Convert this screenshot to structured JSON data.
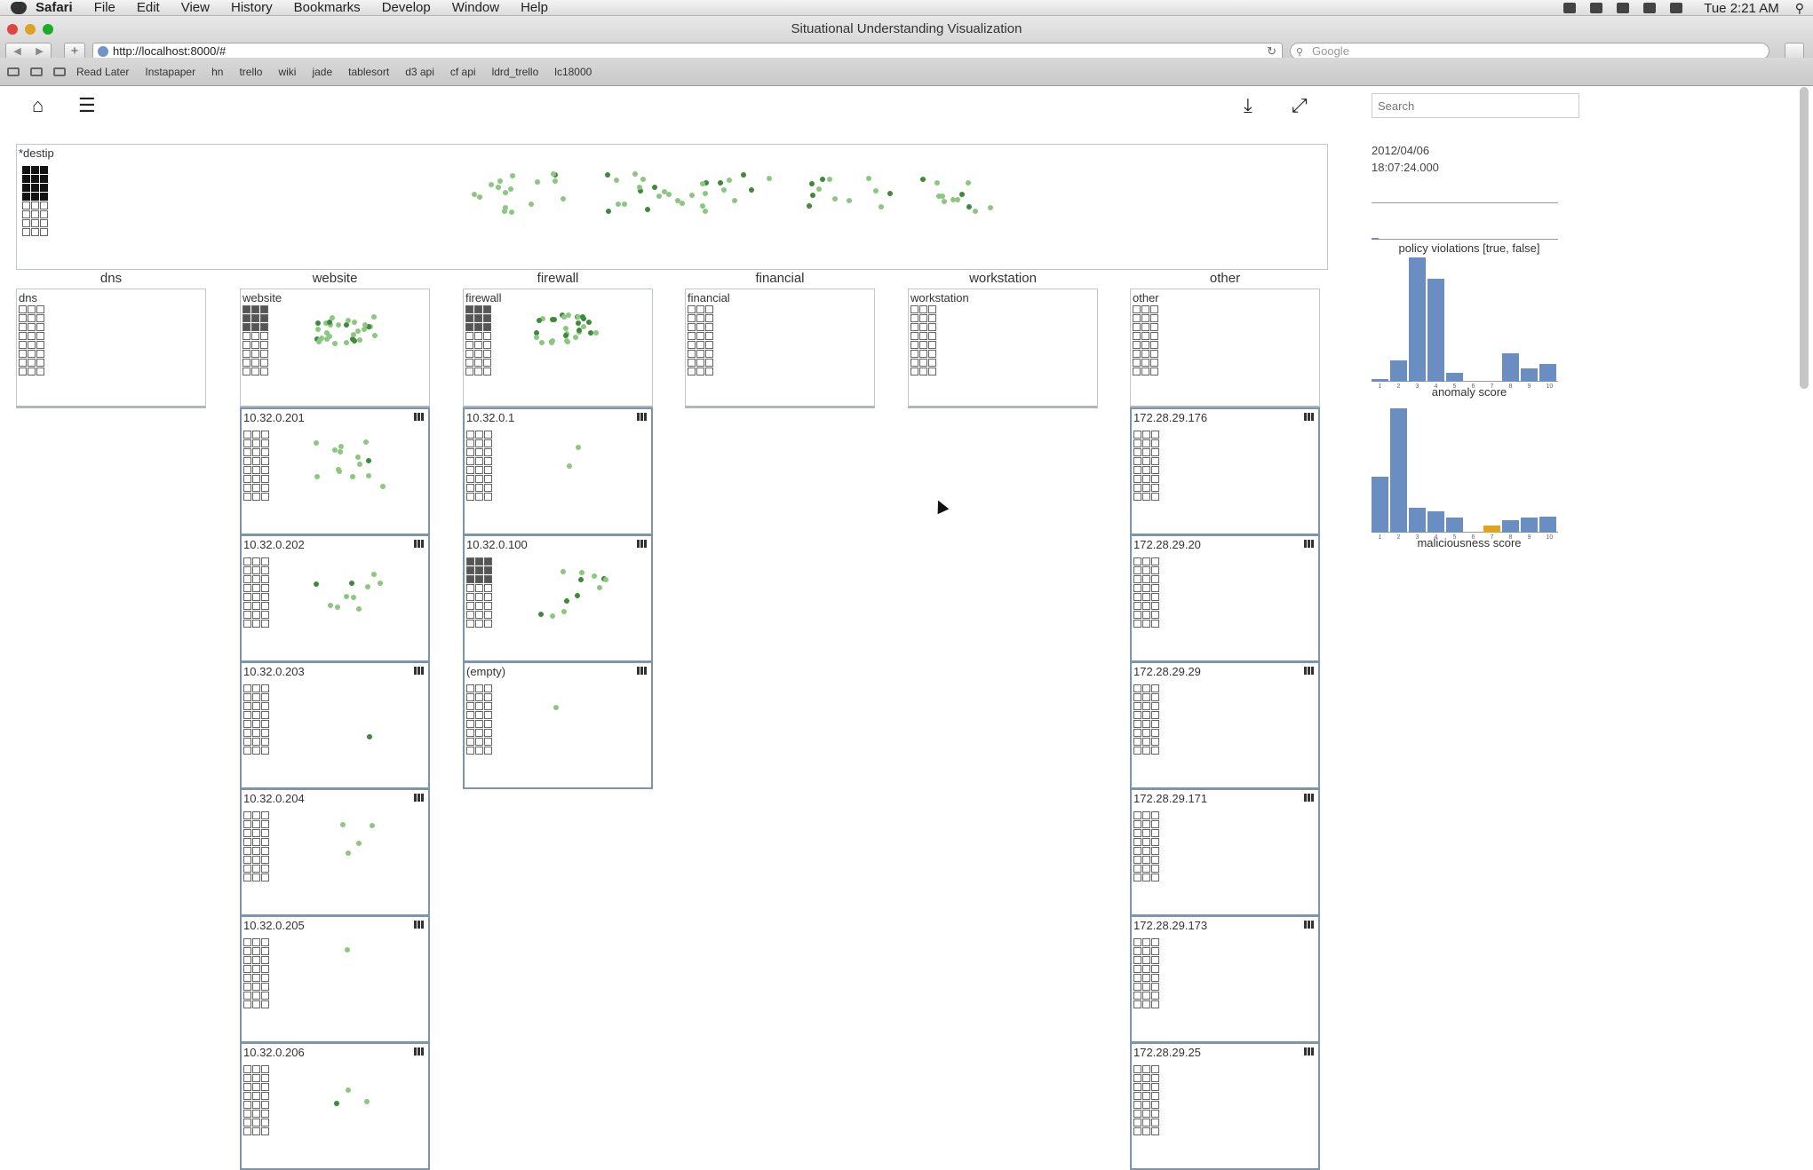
{
  "menubar": {
    "app": "Safari",
    "items": [
      "File",
      "Edit",
      "View",
      "History",
      "Bookmarks",
      "Develop",
      "Window",
      "Help"
    ],
    "clock": "Tue 2:21 AM"
  },
  "browser": {
    "window_title": "Situational Understanding Visualization",
    "url": "http://localhost:8000/#",
    "search_placeholder": "Google",
    "bookmarks": [
      "Read Later",
      "Instapaper",
      "hn",
      "trello",
      "wiki",
      "jade",
      "tablesort",
      "d3 api",
      "cf api",
      "ldrd_trello",
      "lc18000"
    ]
  },
  "toolbar": {
    "home_icon": "home-icon",
    "list_icon": "list-icon",
    "download_icon": "download-icon",
    "expand_icon": "expand-icon"
  },
  "top_panel": {
    "label": "*destip"
  },
  "columns": [
    {
      "title": "dns",
      "summary_label": "dns",
      "hosts": []
    },
    {
      "title": "website",
      "summary_label": "website",
      "hosts": [
        "10.32.0.201",
        "10.32.0.202",
        "10.32.0.203",
        "10.32.0.204",
        "10.32.0.205",
        "10.32.0.206"
      ]
    },
    {
      "title": "firewall",
      "summary_label": "firewall",
      "hosts": [
        "10.32.0.1",
        "10.32.0.100",
        "(empty)"
      ]
    },
    {
      "title": "financial",
      "summary_label": "financial",
      "hosts": []
    },
    {
      "title": "workstation",
      "summary_label": "workstation",
      "hosts": []
    },
    {
      "title": "other",
      "summary_label": "other",
      "hosts": [
        "172.28.29.176",
        "172.28.29.20",
        "172.28.29.29",
        "172.28.29.171",
        "172.28.29.173",
        "172.28.29.25"
      ]
    }
  ],
  "sidebar": {
    "search_placeholder": "Search",
    "date": "2012/04/06",
    "time": "18:07:24.000",
    "charts": [
      {
        "caption": "policy violations [true, false]",
        "values": [
          1.0,
          0
        ]
      },
      {
        "caption": "anomaly score",
        "ticks": [
          "1",
          "2",
          "3",
          "4",
          "5",
          "6",
          "7",
          "8",
          "9",
          "10"
        ],
        "values": [
          2,
          17,
          100,
          83,
          7,
          0,
          0,
          23,
          11,
          14
        ]
      },
      {
        "caption": "maliciousness score",
        "ticks": [
          "1",
          "2",
          "3",
          "4",
          "5",
          "6",
          "7",
          "8",
          "9",
          "10"
        ],
        "values": [
          45,
          100,
          20,
          17,
          12,
          0,
          6,
          10,
          12,
          13
        ],
        "highlight_index": 6,
        "highlight_color": "#e0a520"
      }
    ],
    "bar_color": "#6a8dc2"
  }
}
